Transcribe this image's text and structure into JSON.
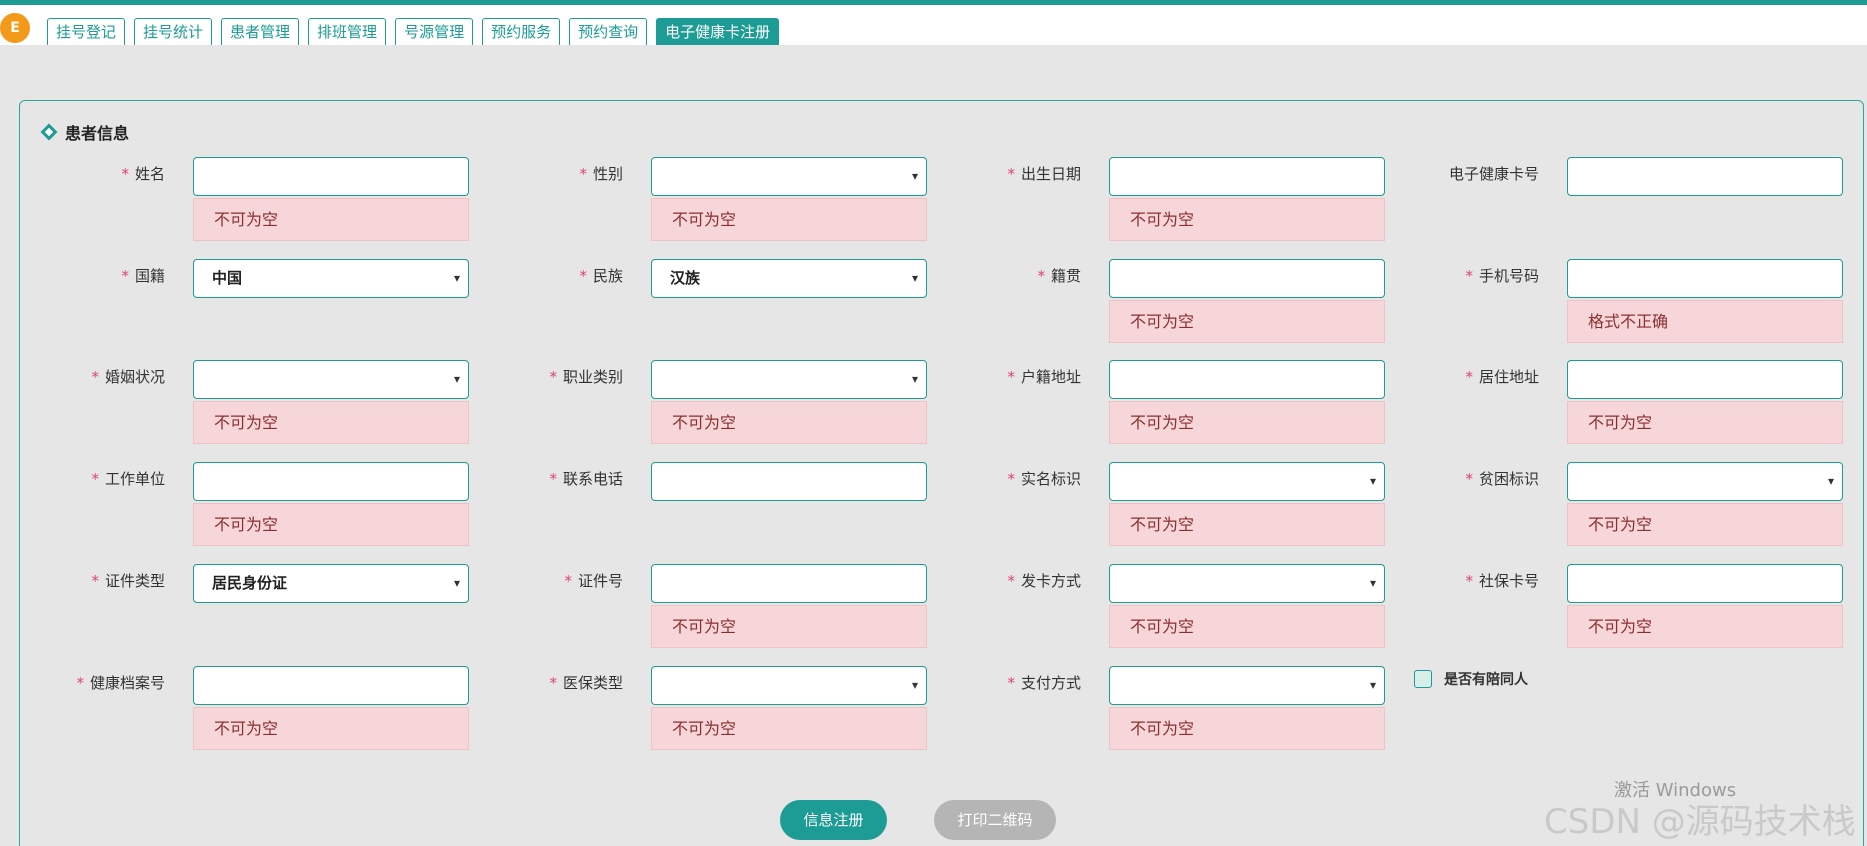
{
  "nav": {
    "logo_text": "E",
    "tabs": [
      "挂号登记",
      "挂号统计",
      "患者管理",
      "排班管理",
      "号源管理",
      "预约服务",
      "预约查询",
      "电子健康卡注册"
    ],
    "active_tab_index": 7
  },
  "section": {
    "title": "患者信息"
  },
  "fields": {
    "name": {
      "label": "姓名",
      "value": "",
      "error": "不可为空"
    },
    "gender": {
      "label": "性别",
      "value": "",
      "error": "不可为空"
    },
    "birthdate": {
      "label": "出生日期",
      "value": "",
      "error": "不可为空"
    },
    "health_card_no": {
      "label": "电子健康卡号",
      "value": ""
    },
    "nationality": {
      "label": "国籍",
      "value": "中国"
    },
    "ethnicity": {
      "label": "民族",
      "value": "汉族"
    },
    "native_place": {
      "label": "籍贯",
      "value": "",
      "error": "不可为空"
    },
    "mobile": {
      "label": "手机号码",
      "value": "",
      "error": "格式不正确"
    },
    "marital_status": {
      "label": "婚姻状况",
      "value": "",
      "error": "不可为空"
    },
    "occupation": {
      "label": "职业类别",
      "value": "",
      "error": "不可为空"
    },
    "registered_address": {
      "label": "户籍地址",
      "value": "",
      "error": "不可为空"
    },
    "residential_address": {
      "label": "居住地址",
      "value": "",
      "error": "不可为空"
    },
    "employer": {
      "label": "工作单位",
      "value": "",
      "error": "不可为空"
    },
    "contact_phone": {
      "label": "联系电话",
      "value": ""
    },
    "realname_flag": {
      "label": "实名标识",
      "value": "",
      "error": "不可为空"
    },
    "poverty_flag": {
      "label": "贫困标识",
      "value": "",
      "error": "不可为空"
    },
    "id_type": {
      "label": "证件类型",
      "value": "居民身份证"
    },
    "id_number": {
      "label": "证件号",
      "value": "",
      "error": "不可为空"
    },
    "card_issue_method": {
      "label": "发卡方式",
      "value": "",
      "error": "不可为空"
    },
    "social_security_no": {
      "label": "社保卡号",
      "value": "",
      "error": "不可为空"
    },
    "health_record_no": {
      "label": "健康档案号",
      "value": "",
      "error": "不可为空"
    },
    "insurance_type": {
      "label": "医保类型",
      "value": "",
      "error": "不可为空"
    },
    "payment_method": {
      "label": "支付方式",
      "value": "",
      "error": "不可为空"
    }
  },
  "companion": {
    "label": "是否有陪同人",
    "checked": false
  },
  "buttons": {
    "register": "信息注册",
    "print_qr": "打印二维码"
  },
  "watermark": {
    "line1": "激活 Windows",
    "line2": "CSDN @源码技术栈"
  },
  "colors": {
    "primary": "#1c9c94",
    "error_bg": "#f7d6d9",
    "required": "#e0436e",
    "disabled": "#b5b5b5",
    "logo": "#f39a1a"
  }
}
